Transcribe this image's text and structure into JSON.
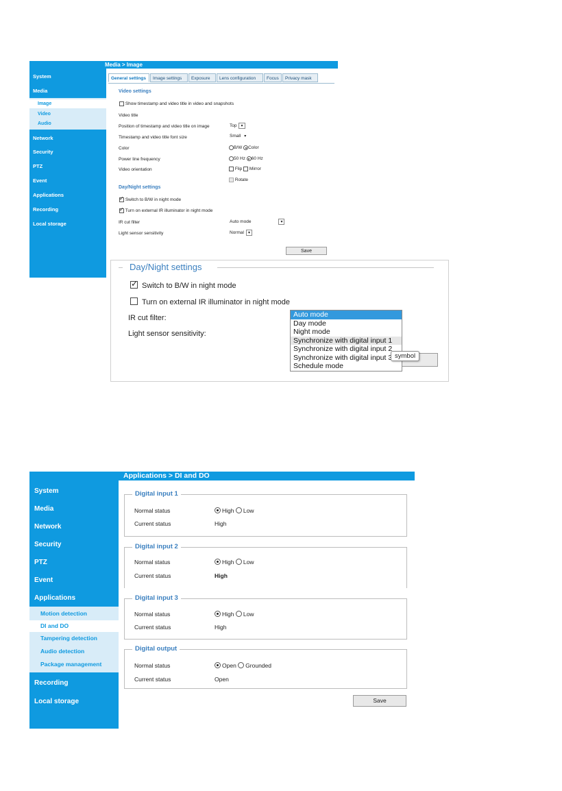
{
  "screen1": {
    "title": "Media > Image",
    "sidebar": [
      "System",
      "Media",
      "Network",
      "Security",
      "PTZ",
      "Event",
      "Applications",
      "Recording",
      "Local storage"
    ],
    "media_sub": [
      "Image",
      "Video",
      "Audio"
    ],
    "tabs": [
      "General settings",
      "Image settings",
      "Exposure",
      "Lens configuration",
      "Focus",
      "Privacy mask"
    ],
    "video_settings_title": "Video settings",
    "show_timestamp": "Show timestamp and video title in video and snapshots",
    "video_title": "Video title",
    "position_label": "Position of timestamp and video title on image",
    "position_value": "Top",
    "font_size_label": "Timestamp and video title font size",
    "font_size_value": "Small",
    "color_label": "Color",
    "color_bw": "B/W",
    "color_color": "Color",
    "power_line_label": "Power line frequency",
    "freq_50": "50 Hz",
    "freq_60": "60 Hz",
    "orientation_label": "Video orientation",
    "flip": "Flip",
    "mirror": "Mirror",
    "rotate": "Rotate",
    "daynight_title": "Day/Night settings",
    "switch_bw": "Switch to B/W in night mode",
    "turn_ir": "Turn on external IR illuminator in night mode",
    "ir_cut_label": "IR cut filter",
    "ir_cut_value": "Auto mode",
    "light_label": "Light sensor sensitivity",
    "light_value": "Normal",
    "save": "Save"
  },
  "zoom": {
    "title": "Day/Night settings",
    "switch_bw": "Switch to B/W in night mode",
    "turn_ir": "Turn on external IR illuminator in night mode",
    "ir_cut_label": "IR cut filter:",
    "light_label": "Light sensor sensitivity:",
    "options": [
      "Auto mode",
      "Day mode",
      "Night mode",
      "Synchronize with digital input 1",
      "Synchronize with digital input 2",
      "Synchronize with digital input 3",
      "Schedule mode"
    ],
    "tooltip": "symbol"
  },
  "screen2": {
    "title": "Applications > DI and DO",
    "sidebar_top": [
      "System",
      "Media",
      "Network",
      "Security",
      "PTZ",
      "Event",
      "Applications"
    ],
    "apps_sub": [
      "Motion detection",
      "DI and DO",
      "Tampering detection",
      "Audio detection",
      "Package management"
    ],
    "sidebar_bottom": [
      "Recording",
      "Local storage"
    ],
    "groups": [
      {
        "legend": "Digital input 1",
        "normal_label": "Normal status",
        "opt1": "High",
        "opt2": "Low",
        "current_label": "Current status",
        "current": "High"
      },
      {
        "legend": "Digital input 2",
        "normal_label": "Normal status",
        "opt1": "High",
        "opt2": "Low",
        "current_label": "Current status",
        "current": "High"
      },
      {
        "legend": "Digital input 3",
        "normal_label": "Normal status",
        "opt1": "High",
        "opt2": "Low",
        "current_label": "Current status",
        "current": "High"
      },
      {
        "legend": "Digital output",
        "normal_label": "Normal status",
        "opt1": "Open",
        "opt2": "Grounded",
        "current_label": "Current status",
        "current": "Open"
      }
    ],
    "save": "Save"
  }
}
